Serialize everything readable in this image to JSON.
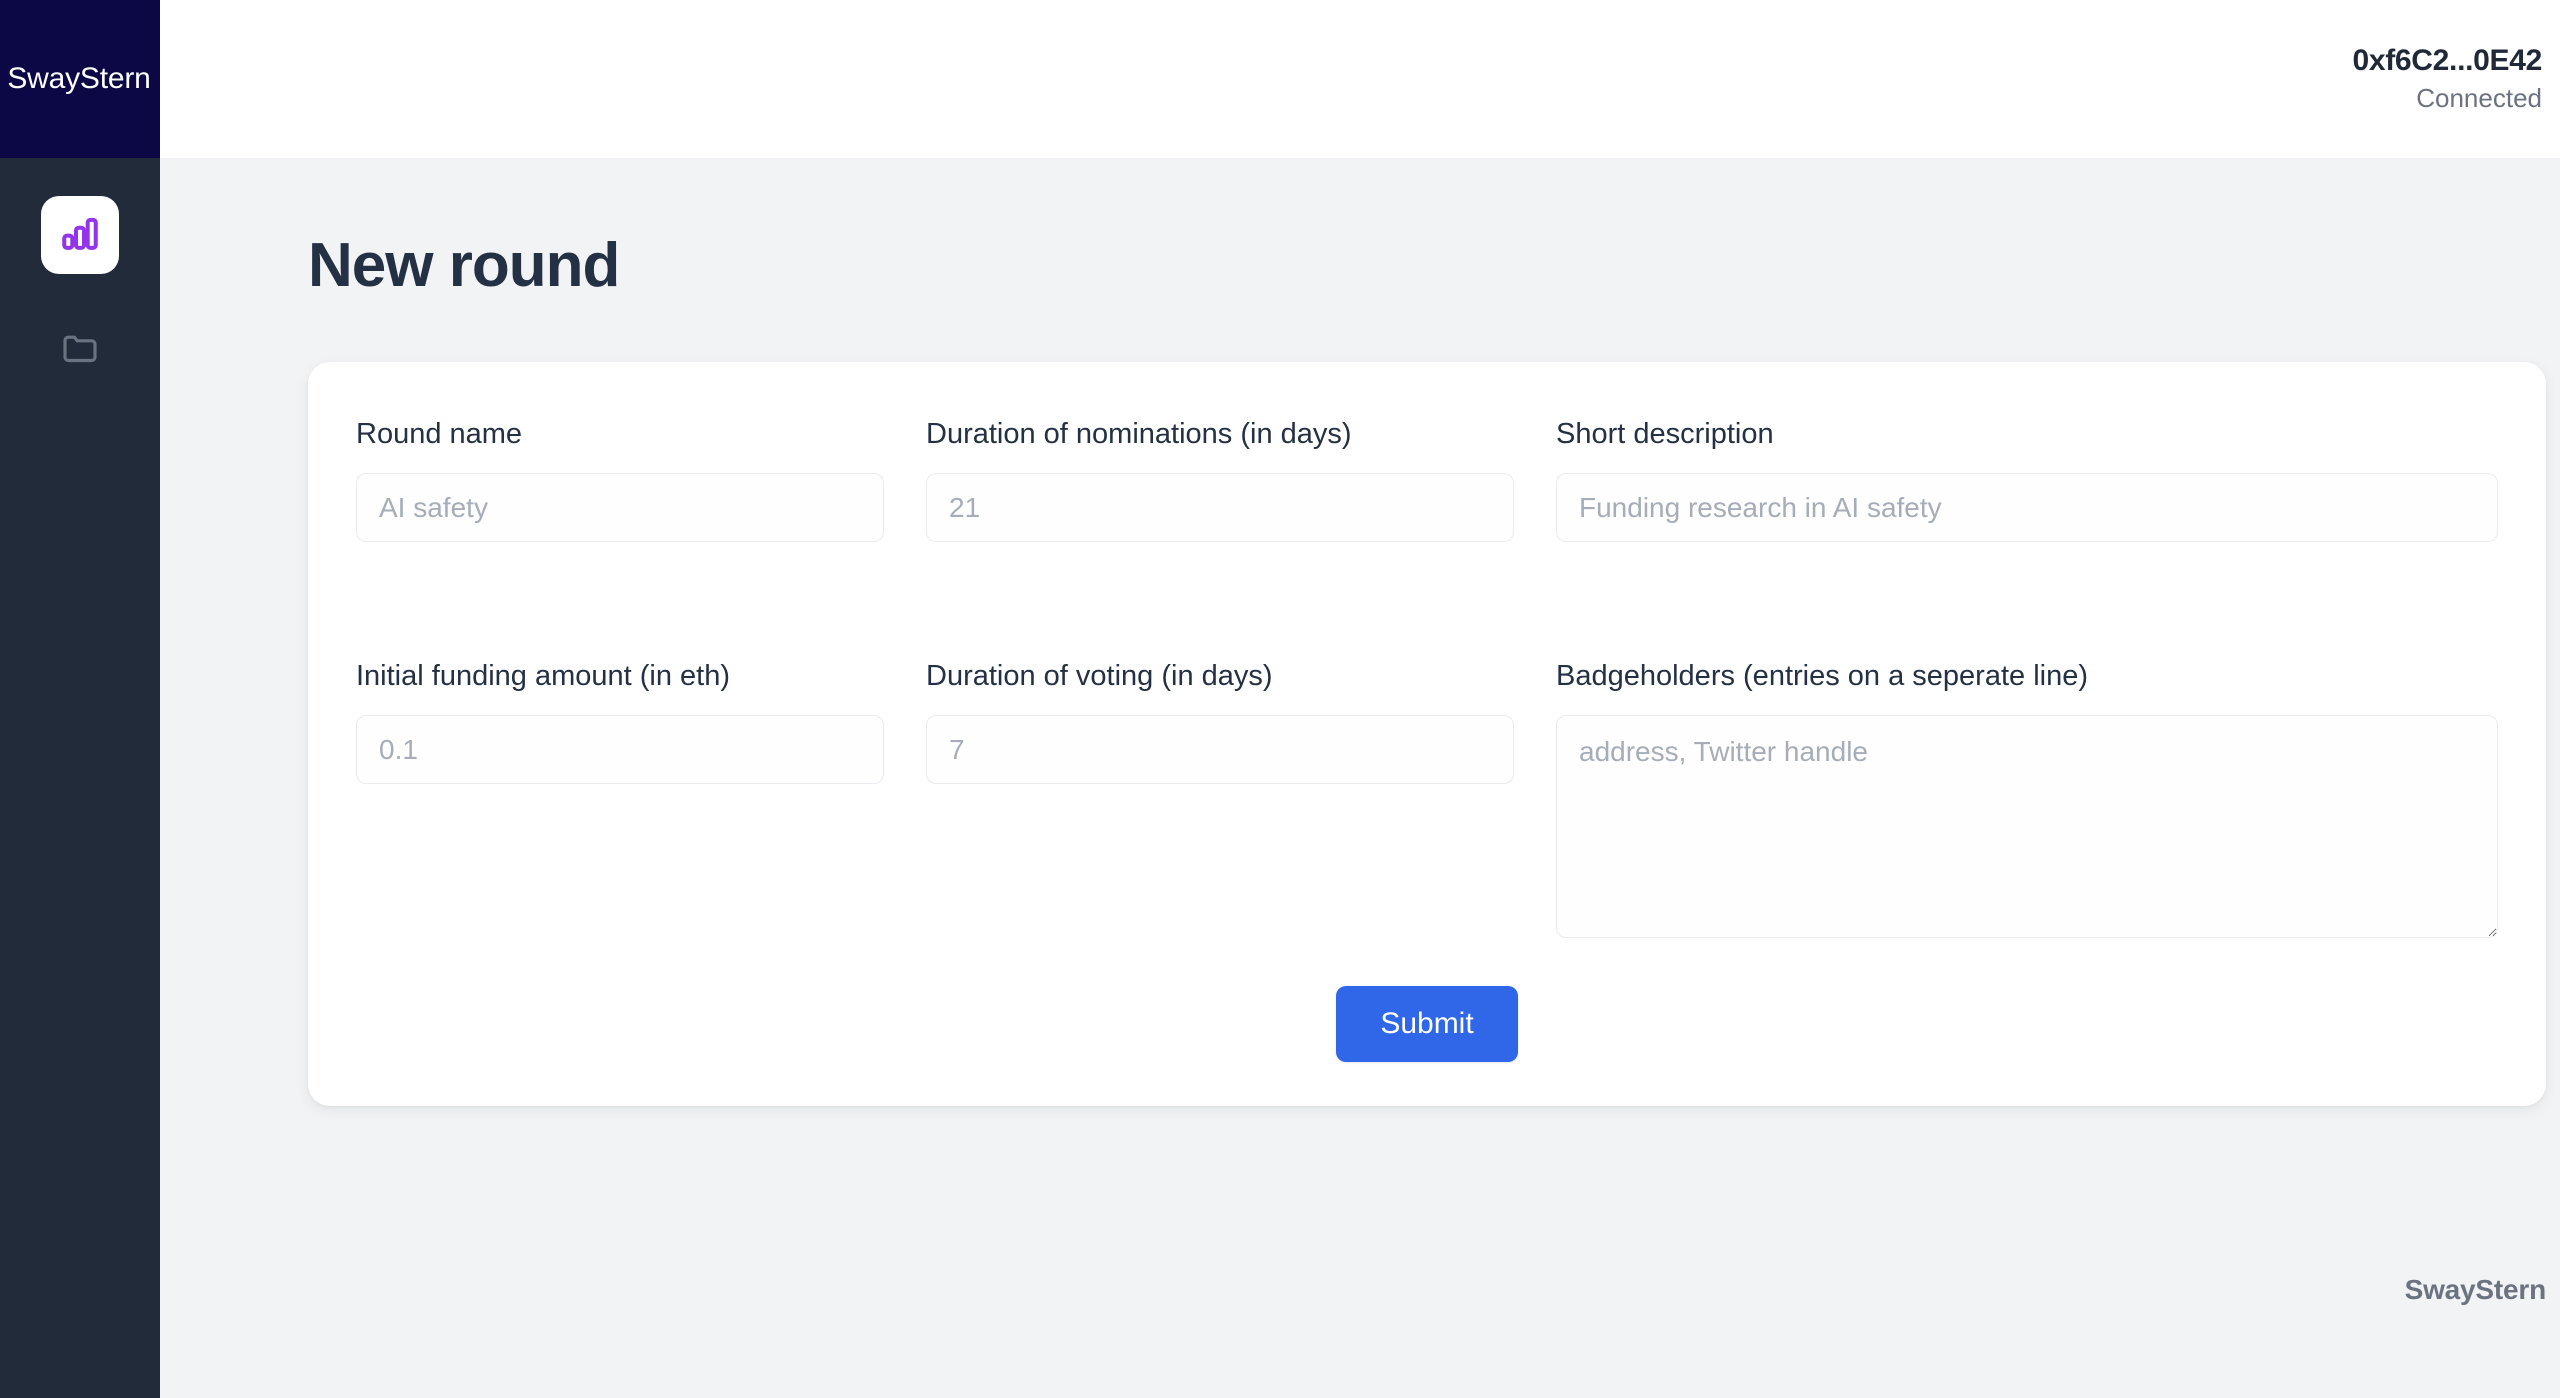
{
  "brand": {
    "name": "SwayStern",
    "footer_name": "SwayStern"
  },
  "sidebar": {
    "items": [
      {
        "icon": "bar-chart-icon",
        "name": "rounds",
        "active": true
      },
      {
        "icon": "folder-icon",
        "name": "projects",
        "active": false
      }
    ],
    "active_icon_color": "#9333ea",
    "inactive_icon_color": "#6b7280",
    "header_bg": "#0b0845",
    "bg": "#222b3a"
  },
  "topbar": {
    "wallet_address": "0xf6C2...0E42",
    "connection_status": "Connected"
  },
  "page": {
    "title": "New round"
  },
  "form": {
    "fields": [
      {
        "label": "Round name",
        "placeholder": "AI safety",
        "value": "",
        "type": "text",
        "name": "round-name"
      },
      {
        "label": "Duration of nominations (in days)",
        "placeholder": "21",
        "value": "",
        "type": "text",
        "name": "duration-of-nominations"
      },
      {
        "label": "Short description",
        "placeholder": "Funding research in AI safety",
        "value": "",
        "type": "text",
        "name": "short-description"
      },
      {
        "label": "Initial funding amount (in eth)",
        "placeholder": "0.1",
        "value": "",
        "type": "text",
        "name": "initial-funding-amount"
      },
      {
        "label": "Duration of voting (in days)",
        "placeholder": "7",
        "value": "",
        "type": "text",
        "name": "duration-of-voting"
      },
      {
        "label": "Badgeholders (entries on a seperate line)",
        "placeholder": "address, Twitter handle",
        "value": "",
        "type": "textarea",
        "name": "badgeholders"
      }
    ],
    "submit_label": "Submit",
    "submit_color": "#2f67e8"
  },
  "colors": {
    "page_bg": "#f1f3f5",
    "card_bg": "#ffffff",
    "text_primary": "#243043",
    "text_muted": "#6b7280",
    "placeholder": "#a6adb8",
    "input_border": "#e9ebef"
  }
}
